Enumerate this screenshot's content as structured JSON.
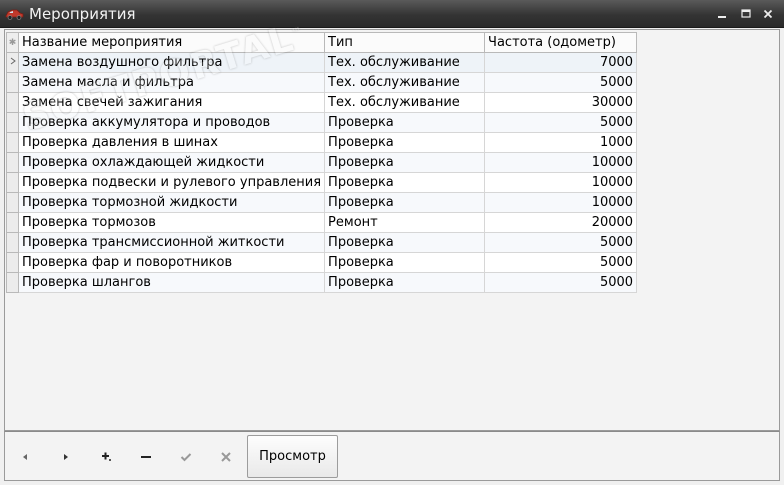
{
  "window": {
    "title": "Мероприятия",
    "icon": "car-icon"
  },
  "grid": {
    "columns": [
      "Название мероприятия",
      "Тип",
      "Частота (одометр)"
    ],
    "rows": [
      {
        "name": "Замена воздушного фильтра",
        "type": "Тех. обслуживание",
        "freq": "7000"
      },
      {
        "name": "Замена масла и фильтра",
        "type": "Тех. обслуживание",
        "freq": "5000"
      },
      {
        "name": "Замена свечей зажигания",
        "type": "Тех. обслуживание",
        "freq": "30000"
      },
      {
        "name": "Проверка аккумулятора и проводов",
        "type": "Проверка",
        "freq": "5000"
      },
      {
        "name": "Проверка давления в шинах",
        "type": "Проверка",
        "freq": "1000"
      },
      {
        "name": "Проверка охлаждающей жидкости",
        "type": "Проверка",
        "freq": "10000"
      },
      {
        "name": "Проверка подвески и рулевого управления",
        "type": "Проверка",
        "freq": "10000"
      },
      {
        "name": "Проверка тормозной жидкости",
        "type": "Проверка",
        "freq": "10000"
      },
      {
        "name": "Проверка тормозов",
        "type": "Ремонт",
        "freq": "20000"
      },
      {
        "name": "Проверка трансмиссионной житкости",
        "type": "Проверка",
        "freq": "5000"
      },
      {
        "name": "Проверка фар и поворотников",
        "type": "Проверка",
        "freq": "5000"
      },
      {
        "name": "Проверка шлангов",
        "type": "Проверка",
        "freq": "5000"
      }
    ]
  },
  "toolbar": {
    "view_label": "Просмотр",
    "icons": [
      "prev-icon",
      "next-icon",
      "add-icon",
      "remove-icon",
      "confirm-icon",
      "cancel-icon"
    ]
  },
  "watermark": {
    "text": "SOFTPORTAL",
    "tm": "™"
  },
  "colors": {
    "titlebar": "#343434",
    "window_bg": "#f0f0f0",
    "grid_line": "#d6d6d6"
  }
}
